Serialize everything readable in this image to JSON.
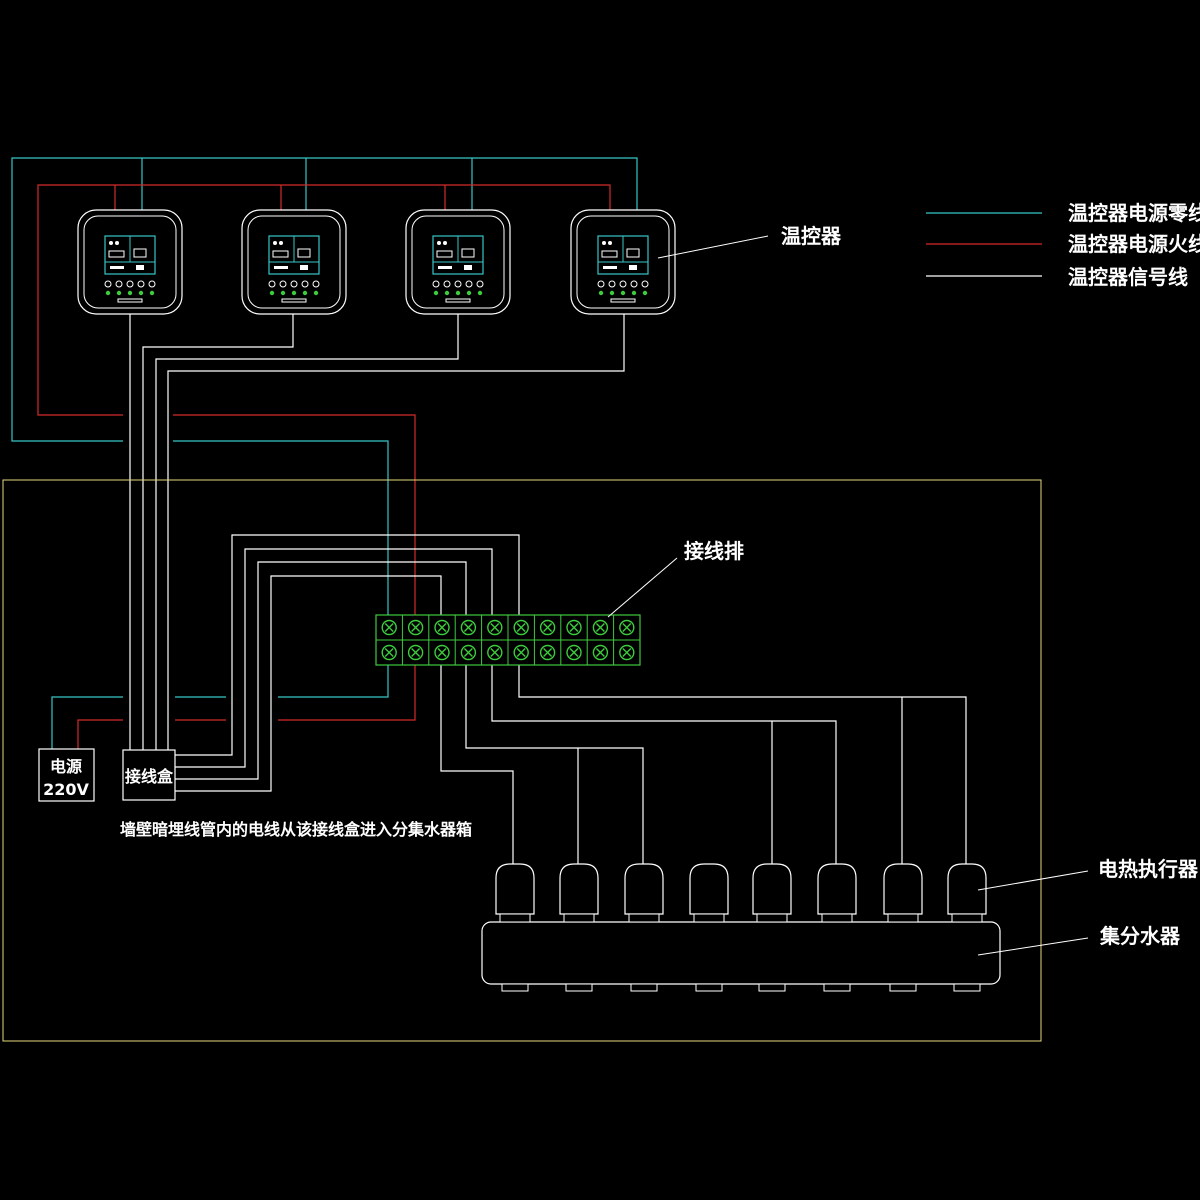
{
  "legend": {
    "neutral_label": "温控器电源零线",
    "live_label": "温控器电源火线",
    "signal_label": "温控器信号线"
  },
  "labels": {
    "thermostat": "温控器",
    "terminal_strip": "接线排",
    "power_line1": "电源",
    "power_line2": "220V",
    "junction_box": "接线盒",
    "note": "墙壁暗埋线管内的电线从该接线盒进入分集水器箱",
    "actuator": "电热执行器",
    "manifold": "集分水器"
  },
  "colors": {
    "neutral": "#37c6c6",
    "live": "#d42b2b",
    "signal": "#ffffff",
    "cabinet": "#e3d87b",
    "terminal": "#3ccc3c",
    "screen": "#37c6c6"
  },
  "counts": {
    "thermostats": 4,
    "terminal_columns": 10,
    "actuators": 8
  }
}
